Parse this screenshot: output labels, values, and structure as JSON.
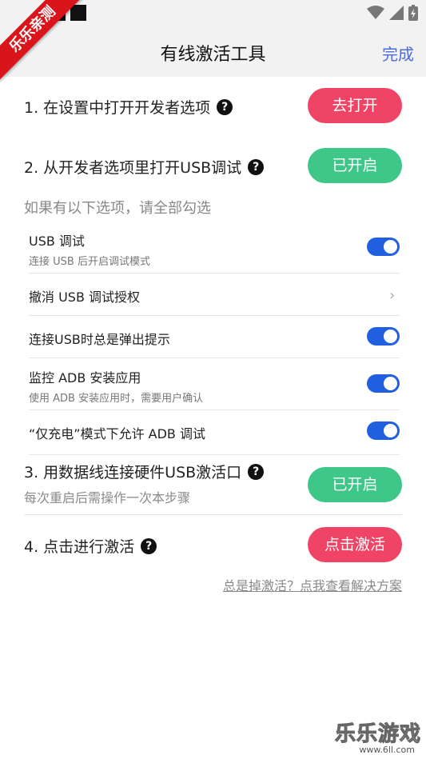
{
  "watermark_ribbon": "乐乐亲测",
  "header": {
    "title": "有线激活工具",
    "done": "完成"
  },
  "steps": [
    {
      "label": "1. 在设置中打开开发者选项",
      "button": "去打开"
    },
    {
      "label": "2. 从开发者选项里打开USB调试",
      "button": "已开启"
    },
    {
      "label": "3. 用数据线连接硬件USB激活口",
      "sub": "每次重启后需操作一次本步骤",
      "button": "已开启"
    },
    {
      "label": "4. 点击进行激活",
      "button": "点击激活"
    }
  ],
  "hint": "如果有以下选项，请全部勾选",
  "options": [
    {
      "label": "USB 调试",
      "desc": "连接 USB 后开启调试模式",
      "on": true
    },
    {
      "label": "撤消 USB 调试授权"
    },
    {
      "label": "连接USB时总是弹出提示",
      "on": true
    },
    {
      "label": "监控 ADB 安装应用",
      "desc": "使用 ADB 安装应用时，需要用户确认",
      "on": true
    },
    {
      "label": "“仅充电”模式下允许 ADB 调试",
      "on": true
    }
  ],
  "help_link": "总是掉激活？点我查看解决方案",
  "watermark": {
    "big": "乐乐游戏",
    "small": "www.6ll.com"
  },
  "colors": {
    "accent_red": "#ef4465",
    "accent_green": "#3ec789",
    "toggle_blue": "#1f5fe0",
    "link_blue": "#4b6bdc"
  }
}
